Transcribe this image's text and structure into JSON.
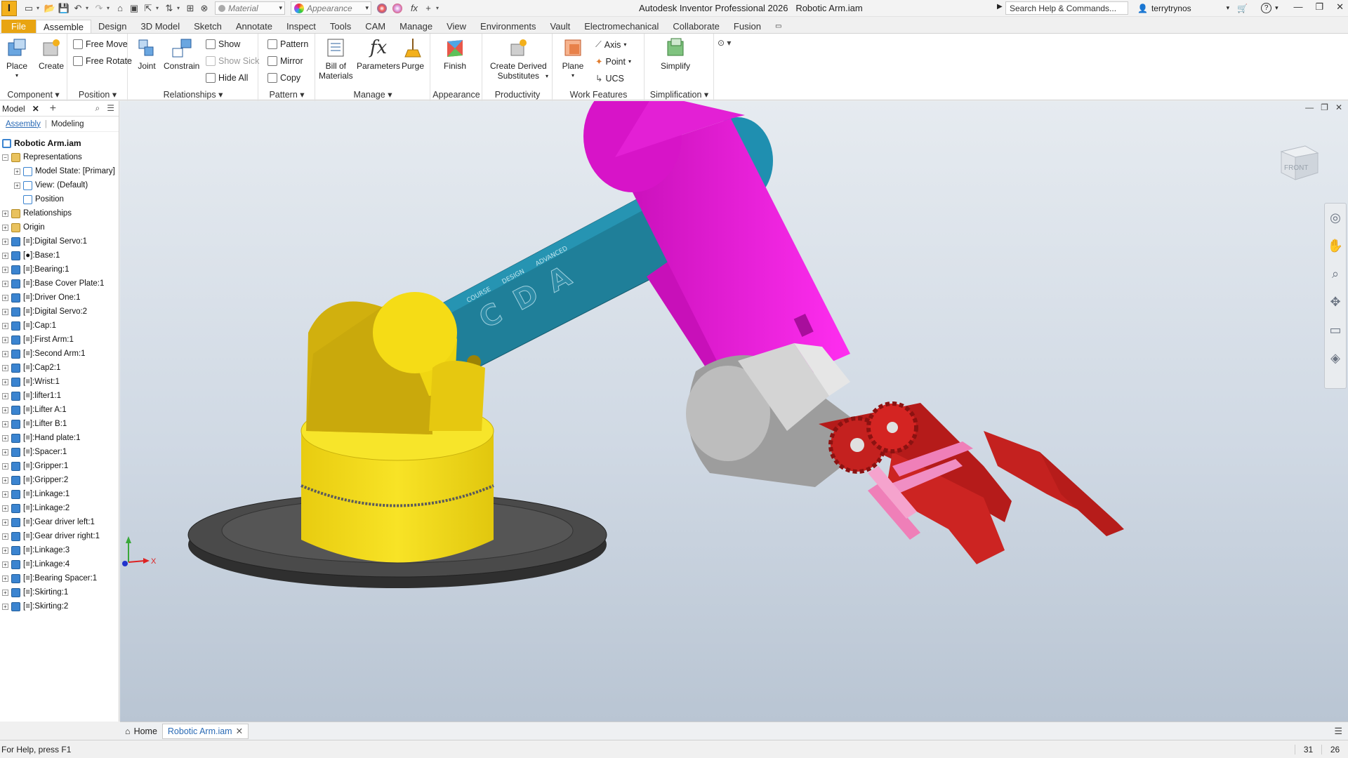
{
  "app": {
    "title": "Autodesk Inventor Professional 2026",
    "document": "Robotic Arm.iam",
    "logo_letter": "I",
    "search_placeholder": "Search Help & Commands...",
    "user": "terrytrynos"
  },
  "quick_access": {
    "material_placeholder": "Material",
    "appearance_placeholder": "Appearance"
  },
  "menu_tabs": [
    "File",
    "Assemble",
    "Design",
    "3D Model",
    "Sketch",
    "Annotate",
    "Inspect",
    "Tools",
    "CAM",
    "Manage",
    "View",
    "Environments",
    "Vault",
    "Electromechanical",
    "Collaborate",
    "Fusion"
  ],
  "active_tab": "Assemble",
  "ribbon": {
    "component": {
      "label": "Component",
      "place": "Place",
      "create": "Create"
    },
    "position": {
      "label": "Position",
      "free_move": "Free Move",
      "free_rotate": "Free Rotate"
    },
    "relationships": {
      "label": "Relationships",
      "joint": "Joint",
      "constrain": "Constrain",
      "show": "Show",
      "show_sick": "Show Sick",
      "hide_all": "Hide All"
    },
    "pattern": {
      "label": "Pattern",
      "pattern": "Pattern",
      "mirror": "Mirror",
      "copy": "Copy"
    },
    "manage": {
      "label": "Manage",
      "bom_line1": "Bill of",
      "bom_line2": "Materials",
      "parameters": "Parameters",
      "purge": "Purge"
    },
    "appearance": {
      "label": "Appearance",
      "finish": "Finish"
    },
    "productivity": {
      "label": "Productivity",
      "derived_line1": "Create Derived",
      "derived_line2": "Substitutes"
    },
    "work_features": {
      "label": "Work Features",
      "plane": "Plane",
      "axis": "Axis",
      "point": "Point",
      "ucs": "UCS"
    },
    "simplification": {
      "label": "Simplification",
      "simplify": "Simplify"
    }
  },
  "browser": {
    "title": "Model",
    "tab_assembly": "Assembly",
    "tab_modeling": "Modeling",
    "root": "Robotic Arm.iam",
    "representations": "Representations",
    "rep_children": [
      "Model State: [Primary]",
      "View: (Default)",
      "Position"
    ],
    "folders": [
      "Relationships",
      "Origin"
    ],
    "parts": [
      "[≡]:Digital Servo:1",
      "[●]:Base:1",
      "[≡]:Bearing:1",
      "[≡]:Base Cover Plate:1",
      "[≡]:Driver One:1",
      "[≡]:Digital Servo:2",
      "[≡]:Cap:1",
      "[≡]:First Arm:1",
      "[≡]:Second Arm:1",
      "[≡]:Cap2:1",
      "[≡]:Wrist:1",
      "[≡]:lifter1:1",
      "[≡]:Lifter A:1",
      "[≡]:Lifter B:1",
      "[≡]:Hand plate:1",
      "[≡]:Spacer:1",
      "[≡]:Gripper:1",
      "[≡]:Gripper:2",
      "[≡]:Linkage:1",
      "[≡]:Linkage:2",
      "[≡]:Gear driver left:1",
      "[≡]:Gear driver right:1",
      "[≡]:Linkage:3",
      "[≡]:Linkage:4",
      "[≡]:Bearing Spacer:1",
      "[≡]:Skirting:1",
      "[≡]:Skirting:2"
    ]
  },
  "viewcube_label": "FRONT",
  "arm_engraving": [
    "ADVANCED",
    "DESIGN",
    "COURSE"
  ],
  "arm_letters": [
    "A",
    "D",
    "C"
  ],
  "axes": {
    "x": "X"
  },
  "doc_tabs": {
    "home": "Home",
    "active": "Robotic Arm.iam"
  },
  "status": {
    "help": "For Help, press F1",
    "count1": "31",
    "count2": "26"
  },
  "colors": {
    "accent": "#e8a412",
    "yellow": "#f2d91a",
    "teal": "#21809b",
    "magenta": "#e312d4",
    "red": "#c4211f",
    "pink": "#ef7fb8",
    "gray": "#bdbdbd",
    "base_plate": "#3f3f3f"
  }
}
